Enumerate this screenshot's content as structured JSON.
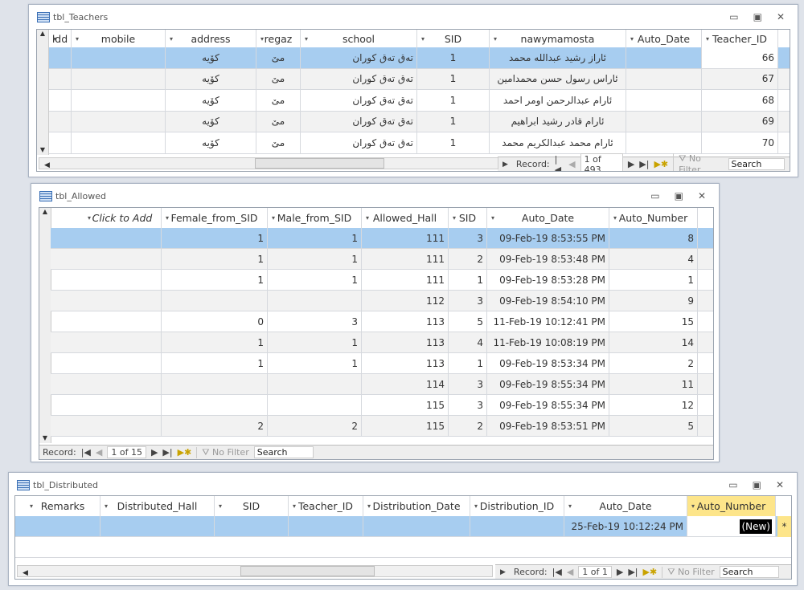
{
  "teachers": {
    "title": "tbl_Teachers",
    "columns": [
      "ldd",
      "mobile",
      "address",
      "regaz",
      "school",
      "SID",
      "nawymamosta",
      "Auto_Date",
      "Teacher_ID"
    ],
    "rows": [
      [
        "",
        "",
        "كۆيه",
        "مێ",
        "تەق تەق كوران",
        "1",
        "ئاراز رشيد عبدالله محمد",
        "",
        "66"
      ],
      [
        "",
        "",
        "كۆيه",
        "مێ",
        "تەق تەق كوران",
        "1",
        "ئاراس رسول حسن محمدامين",
        "",
        "67"
      ],
      [
        "",
        "",
        "كۆيه",
        "مێ",
        "تەق تەق كوران",
        "1",
        "ئارام عبدالرحمن اومر احمد",
        "",
        "68"
      ],
      [
        "",
        "",
        "كۆيه",
        "مێ",
        "تەق تەق كوران",
        "1",
        "ئارام قادر رشيد ابراهيم",
        "",
        "69"
      ],
      [
        "",
        "",
        "كۆيه",
        "مێ",
        "تەق تەق كوران",
        "1",
        "ئارام محمد عبدالكريم محمد",
        "",
        "70"
      ]
    ],
    "nav": {
      "record_label": "Record:",
      "position": "1 of 493",
      "filter": "No Filter",
      "search": "Search"
    }
  },
  "allowed": {
    "title": "tbl_Allowed",
    "columns": [
      "Click to Add",
      "Female_from_SID",
      "Male_from_SID",
      "Allowed_Hall",
      "SID",
      "Auto_Date",
      "Auto_Number"
    ],
    "rows": [
      [
        "",
        "1",
        "1",
        "111",
        "3",
        "09-Feb-19 8:53:55 PM",
        "8"
      ],
      [
        "",
        "1",
        "1",
        "111",
        "2",
        "09-Feb-19 8:53:48 PM",
        "4"
      ],
      [
        "",
        "1",
        "1",
        "111",
        "1",
        "09-Feb-19 8:53:28 PM",
        "1"
      ],
      [
        "",
        "",
        "",
        "112",
        "3",
        "09-Feb-19 8:54:10 PM",
        "9"
      ],
      [
        "",
        "0",
        "3",
        "113",
        "5",
        "11-Feb-19 10:12:41 PM",
        "15"
      ],
      [
        "",
        "1",
        "1",
        "113",
        "4",
        "11-Feb-19 10:08:19 PM",
        "14"
      ],
      [
        "",
        "1",
        "1",
        "113",
        "1",
        "09-Feb-19 8:53:34 PM",
        "2"
      ],
      [
        "",
        "",
        "",
        "114",
        "3",
        "09-Feb-19 8:55:34 PM",
        "11"
      ],
      [
        "",
        "",
        "",
        "115",
        "3",
        "09-Feb-19 8:55:34 PM",
        "12"
      ],
      [
        "",
        "2",
        "2",
        "115",
        "2",
        "09-Feb-19 8:53:51 PM",
        "5"
      ]
    ],
    "nav": {
      "record_label": "Record:",
      "position": "1 of 15",
      "filter": "No Filter",
      "search": "Search"
    }
  },
  "distributed": {
    "title": "tbl_Distributed",
    "columns": [
      "Remarks",
      "Distributed_Hall",
      "SID",
      "Teacher_ID",
      "Distribution_Date",
      "Distribution_ID",
      "Auto_Date",
      "Auto_Number"
    ],
    "rows": [
      [
        "",
        "",
        "",
        "",
        "",
        "",
        "25-Feb-19 10:12:24 PM",
        "(New)"
      ]
    ],
    "new_record_marker": "*",
    "nav": {
      "record_label": "Record:",
      "position": "1 of 1",
      "filter": "No Filter",
      "search": "Search"
    }
  },
  "colors": {
    "selected_row": "#a7cdf0",
    "active_header": "#fde58a"
  }
}
